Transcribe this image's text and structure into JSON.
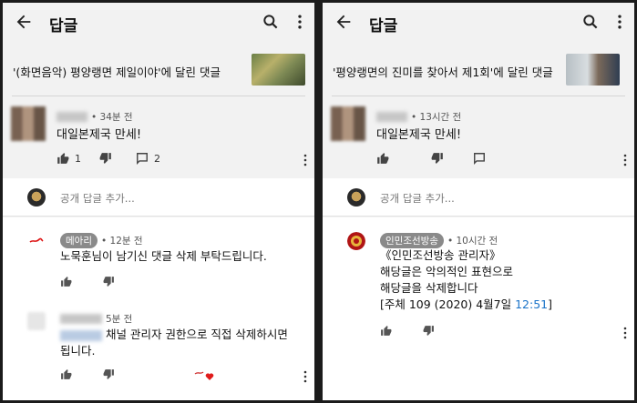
{
  "left": {
    "appbar": {
      "title": "답글"
    },
    "video_title": "'(화면음악) 평양랭면 제일이야'에 달린 댓글",
    "comment": {
      "time": "• 34분 전",
      "text": "대일본제국 만세!",
      "likes": "1",
      "replies": "2"
    },
    "reply_placeholder": "공개 답글 추가...",
    "replies": [
      {
        "channel": "메아리",
        "time": "• 12분 전",
        "text": "노묵훈님이 남기신 댓글 삭제 부탁드립니다."
      },
      {
        "time": "5분 전",
        "text_line1": "채널 관리자 권한으로 직접 삭제하시면",
        "text_line2": "됩니다."
      }
    ]
  },
  "right": {
    "appbar": {
      "title": "답글"
    },
    "video_title": "'평양랭면의 진미를 찾아서 제1회'에 달린 댓글",
    "comment": {
      "time": "• 13시간 전",
      "text": "대일본제국 만세!"
    },
    "reply_placeholder": "공개 답글 추가...",
    "replies": [
      {
        "channel": "인민조선방송",
        "time": "• 10시간 전",
        "line1": "《인민조선방송 관리자》",
        "line2": "해당글은 악의적인 표현으로",
        "line3": "해당글을 삭제합니다",
        "line4_prefix": "[주체 109 (2020) 4월7일 ",
        "line4_time": "12:51",
        "line4_suffix": "]"
      }
    ]
  },
  "colors": {
    "link": "#1a73c8",
    "chip": "#8a8a8a",
    "background": "#f2f2f2"
  },
  "icons": [
    "back-arrow-icon",
    "search-icon",
    "more-vert-icon",
    "thumb-up-icon",
    "thumb-down-icon",
    "comment-icon",
    "heart-icon"
  ]
}
